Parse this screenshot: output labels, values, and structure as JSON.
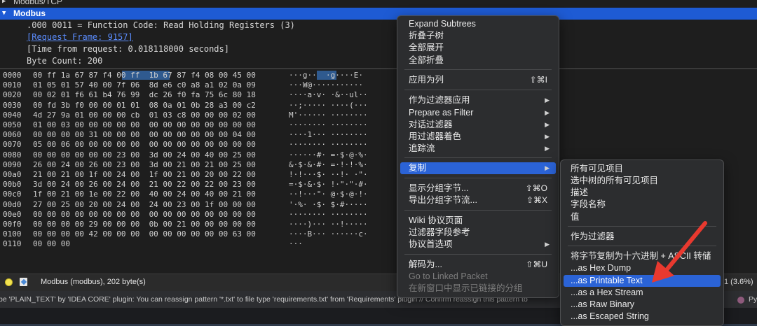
{
  "detail": {
    "tcp_row": "Modbus/TCP",
    "modbus_row": "Modbus",
    "function_code": ".000 0011 = Function Code: Read Holding Registers (3)",
    "request_frame": "[Request Frame: 9157]",
    "time_from_request": "[Time from request: 0.018118000 seconds]",
    "byte_count": "Byte Count: 200"
  },
  "hex": {
    "rows": [
      {
        "offset": "0000",
        "bytes": "00 ff 1a 67 87 f4 00 ff  1b 67 87 f4 08 00 45 00",
        "ascii": "···g··  ·g····E·"
      },
      {
        "offset": "0010",
        "bytes": "01 05 01 57 40 00 7f 06  8d e6 c0 a8 a1 02 0a 09",
        "ascii": "···W@···········"
      },
      {
        "offset": "0020",
        "bytes": "00 02 01 f6 61 b4 76 99  dc 26 f0 fa 75 6c 80 18",
        "ascii": "····a·v· ·&··ul··"
      },
      {
        "offset": "0030",
        "bytes": "00 fd 3b f0 00 00 01 01  08 0a 01 0b 28 a3 00 c2",
        "ascii": "··;····· ····(···"
      },
      {
        "offset": "0040",
        "bytes": "4d 27 9a 01 00 00 00 cb  01 03 c8 00 00 00 02 00",
        "ascii": "M'······ ········"
      },
      {
        "offset": "0050",
        "bytes": "01 00 03 00 00 00 00 00  00 00 00 00 00 00 00 00",
        "ascii": "········ ········"
      },
      {
        "offset": "0060",
        "bytes": "00 00 00 00 31 00 00 00  00 00 00 00 00 00 04 00",
        "ascii": "····1··· ········"
      },
      {
        "offset": "0070",
        "bytes": "05 00 06 00 00 00 00 00  00 00 00 00 00 00 00 00",
        "ascii": "········ ········"
      },
      {
        "offset": "0080",
        "bytes": "00 00 00 00 00 00 23 00  3d 00 24 00 40 00 25 00",
        "ascii": "······#· =·$·@·%·"
      },
      {
        "offset": "0090",
        "bytes": "26 00 24 00 26 00 23 00  3d 00 21 00 21 00 25 00",
        "ascii": "&·$·&·#· =·!·!·%·"
      },
      {
        "offset": "00a0",
        "bytes": "21 00 21 00 1f 00 24 00  1f 00 21 00 20 00 22 00",
        "ascii": "!·!···$· ··!· ·\"·"
      },
      {
        "offset": "00b0",
        "bytes": "3d 00 24 00 26 00 24 00  21 00 22 00 22 00 23 00",
        "ascii": "=·$·&·$· !·\"·\"·#·"
      },
      {
        "offset": "00c0",
        "bytes": "1f 00 21 00 1e 00 22 00  40 00 24 00 40 00 21 00",
        "ascii": "··!···\"· @·$·@·!·"
      },
      {
        "offset": "00d0",
        "bytes": "27 00 25 00 20 00 24 00  24 00 23 00 1f 00 00 00",
        "ascii": "'·%· ·$· $·#·····"
      },
      {
        "offset": "00e0",
        "bytes": "00 00 00 00 00 00 00 00  00 00 00 00 00 00 00 00",
        "ascii": "········ ········"
      },
      {
        "offset": "00f0",
        "bytes": "00 00 00 00 29 00 00 00  0b 00 21 00 00 00 00 00",
        "ascii": "····)··· ··!·····"
      },
      {
        "offset": "0100",
        "bytes": "00 00 00 00 42 00 00 00  00 00 00 00 00 00 63 00",
        "ascii": "····B··· ······c·"
      },
      {
        "offset": "0110",
        "bytes": "00 00 00",
        "ascii": "···"
      }
    ]
  },
  "status": {
    "text": "Modbus (modbus), 202 byte(s)",
    "right": "1 (3.6%)"
  },
  "ide": {
    "notice": "pe 'PLAIN_TEXT' by 'IDEA CORE' plugin: You can reassign pattern '*.txt' to file type 'requirements.txt' from 'Requirements' plugin // Confirm reassign this pattern to",
    "right1": "ula",
    "right2": "Py"
  },
  "context_menu": {
    "items": [
      {
        "label": "Expand Subtrees",
        "shortcut": "",
        "submenu": false,
        "disabled": false
      },
      {
        "label": "折叠子树",
        "shortcut": "",
        "submenu": false,
        "disabled": false
      },
      {
        "label": "全部展开",
        "shortcut": "",
        "submenu": false,
        "disabled": false
      },
      {
        "label": "全部折叠",
        "shortcut": "",
        "submenu": false,
        "disabled": false
      },
      {
        "label": "应用为列",
        "shortcut": "⇧⌘I",
        "submenu": false,
        "disabled": false
      },
      {
        "label": "作为过滤器应用",
        "shortcut": "",
        "submenu": true,
        "disabled": false
      },
      {
        "label": "Prepare as Filter",
        "shortcut": "",
        "submenu": true,
        "disabled": false
      },
      {
        "label": "对话过滤器",
        "shortcut": "",
        "submenu": true,
        "disabled": false
      },
      {
        "label": "用过滤器着色",
        "shortcut": "",
        "submenu": true,
        "disabled": false
      },
      {
        "label": "追踪流",
        "shortcut": "",
        "submenu": true,
        "disabled": false
      },
      {
        "label": "复制",
        "shortcut": "",
        "submenu": true,
        "disabled": false
      },
      {
        "label": "显示分组字节...",
        "shortcut": "⇧⌘O",
        "submenu": false,
        "disabled": false
      },
      {
        "label": "导出分组字节流...",
        "shortcut": "⇧⌘X",
        "submenu": false,
        "disabled": false
      },
      {
        "label": "Wiki 协议页面",
        "shortcut": "",
        "submenu": false,
        "disabled": false
      },
      {
        "label": "过滤器字段参考",
        "shortcut": "",
        "submenu": false,
        "disabled": false
      },
      {
        "label": "协议首选项",
        "shortcut": "",
        "submenu": true,
        "disabled": false
      },
      {
        "label": "解码为...",
        "shortcut": "⇧⌘U",
        "submenu": false,
        "disabled": false
      },
      {
        "label": "Go to Linked Packet",
        "shortcut": "",
        "submenu": false,
        "disabled": true
      },
      {
        "label": "在新窗口中显示已链接的分组",
        "shortcut": "",
        "submenu": false,
        "disabled": true
      }
    ]
  },
  "copy_menu": {
    "items": [
      {
        "label": "所有可见项目"
      },
      {
        "label": "选中树的所有可见项目"
      },
      {
        "label": "描述"
      },
      {
        "label": "字段名称"
      },
      {
        "label": "值"
      },
      {
        "label": "作为过滤器"
      },
      {
        "label": "将字节复制为十六进制 + ASCII 转储"
      },
      {
        "label": "...as Hex Dump"
      },
      {
        "label": "...as Printable Text"
      },
      {
        "label": "...as a Hex Stream"
      },
      {
        "label": "...as Raw Binary"
      },
      {
        "label": "...as Escaped String"
      }
    ]
  },
  "colors": {
    "selection": "#1e5bd4",
    "menu_highlight": "#2b63d6",
    "annotation_arrow": "#e8392f",
    "hex_highlight": "#2f5a8f"
  }
}
